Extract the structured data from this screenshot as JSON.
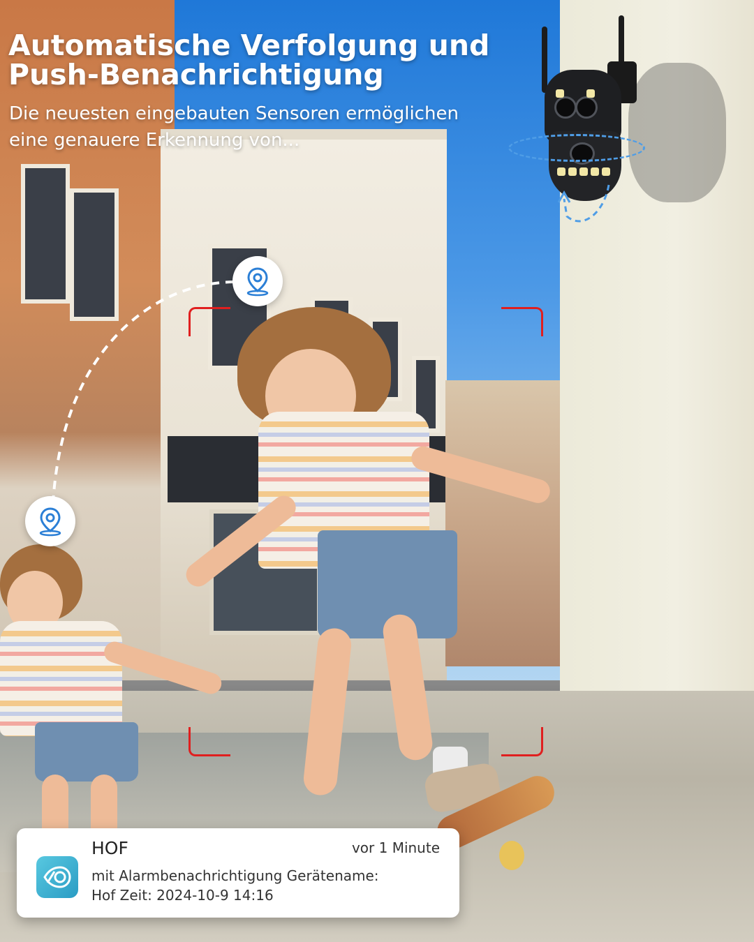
{
  "hero": {
    "headline": "Automatische Verfolgung und\nPush-Benachrichtigung",
    "subline": "Die neuesten eingebauten Sensoren ermöglichen\neine genauere Erkennung von..."
  },
  "notification": {
    "app_name": "HOF",
    "time_ago": "vor 1 Minute",
    "message": "mit Alarmbenachrichtigung Gerätename:\nHof Zeit: 2024-10-9 14:16"
  },
  "icons": {
    "location_pin": "location-pin-icon",
    "app": "camera-eye-icon",
    "rotation": "rotation-arrow-icon"
  },
  "colors": {
    "tracking_frame": "#e01f1f",
    "path_dash": "#ffffff",
    "rotation_arrow": "#4f9de6",
    "app_icon": "#3bb1d4"
  }
}
